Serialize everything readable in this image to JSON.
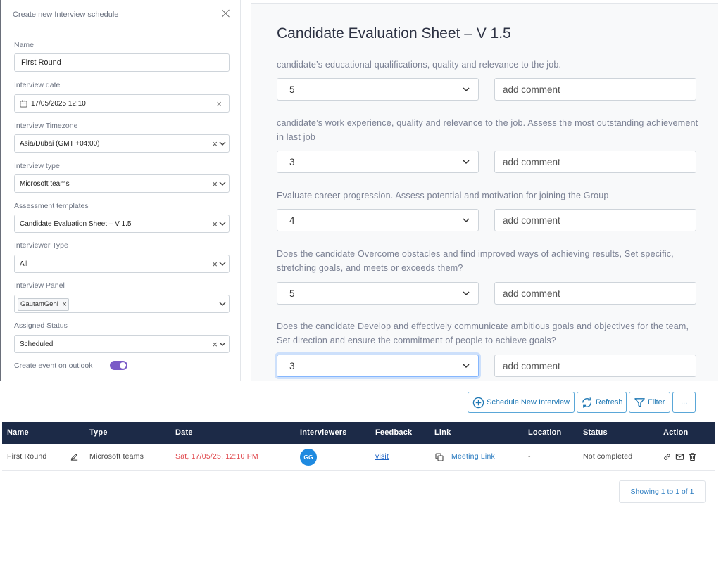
{
  "form": {
    "title": "Create new Interview schedule",
    "name_label": "Name",
    "name_value": "First Round",
    "date_label": "Interview date",
    "date_value": "17/05/2025 12:10",
    "timezone_label": "Interview Timezone",
    "timezone_value": "Asia/Dubai (GMT +04:00)",
    "type_label": "Interview type",
    "type_value": "Microsoft teams",
    "template_label": "Assessment templates",
    "template_value": "Candidate Evaluation Sheet – V 1.5",
    "interviewer_type_label": "Interviewer Type",
    "interviewer_type_value": "All",
    "panel_label": "Interview Panel",
    "panel_tags": [
      "GautamGehi"
    ],
    "status_label": "Assigned Status",
    "status_value": "Scheduled",
    "outlook_label": "Create event on outlook",
    "outlook_enabled": true,
    "clear_glyph": "×"
  },
  "evaluation": {
    "title": "Candidate Evaluation Sheet – V 1.5",
    "comment_placeholder": "add comment",
    "questions": [
      {
        "text": "candidate’s educational qualifications, quality and relevance to the job.",
        "score": "5"
      },
      {
        "text": "candidate’s work experience, quality and relevance to the job. Assess the most outstanding achievement in last job",
        "score": "3"
      },
      {
        "text": "Evaluate career progression. Assess potential and motivation for joining the Group",
        "score": "4"
      },
      {
        "text": "Does the candidate Overcome obstacles and find improved ways of achieving results, Set specific, stretching goals, and meets or exceeds them?",
        "score": "5"
      },
      {
        "text": "Does the candidate Develop and effectively communicate ambitious goals and objectives for the team, Set direction and ensure the commitment of people to achieve goals?",
        "score": "3"
      }
    ]
  },
  "toolbar": {
    "schedule_label": "Schedule New Interview",
    "refresh_label": "Refresh",
    "filter_label": "Filter",
    "more_label": "..."
  },
  "table": {
    "headers": [
      "Name",
      "Type",
      "Date",
      "Interviewers",
      "Feedback",
      "Link",
      "Location",
      "Status",
      "Action"
    ],
    "rows": [
      {
        "name": "First Round",
        "type": "Microsoft teams",
        "date": "Sat, 17/05/25, 12:10 PM",
        "interviewer_initials": "GG",
        "feedback": "visit",
        "link": "Meeting Link",
        "location": "-",
        "status": "Not completed"
      }
    ]
  },
  "pagination": {
    "summary": "Showing 1 to 1 of 1"
  },
  "colors": {
    "accent": "#7b5cc7",
    "table_header": "#1c2a47",
    "link": "#2a7bc0",
    "date_red": "#e0474c",
    "avatar": "#1f8ae0"
  },
  "icons": [
    "close-icon",
    "calendar-icon",
    "chevron-down-icon",
    "clear-icon",
    "plus-circle-icon",
    "refresh-icon",
    "filter-icon",
    "edit-icon",
    "copy-icon",
    "link-icon",
    "mail-icon",
    "trash-icon"
  ]
}
